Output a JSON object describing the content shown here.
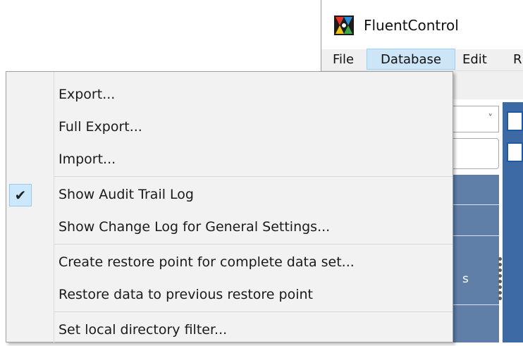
{
  "app": {
    "title": "FluentControl",
    "logo_icon": "fluentcontrol-logo-icon"
  },
  "menubar": {
    "items": [
      {
        "label": "File"
      },
      {
        "label": "Database"
      },
      {
        "label": "Edit"
      },
      {
        "label": "R"
      }
    ],
    "active_highlight": "#cde6f7"
  },
  "background": {
    "combo_text": ")",
    "combo_arrow": "˅",
    "panel_text": "s"
  },
  "dropdown": {
    "items": [
      {
        "label": "Export...",
        "checked": false
      },
      {
        "label": "Full Export...",
        "checked": false
      },
      {
        "label": "Import...",
        "checked": false
      },
      {
        "label": "Show Audit Trail Log",
        "checked": true
      },
      {
        "label": "Show Change Log for General Settings...",
        "checked": false
      },
      {
        "label": "Create restore point for complete data set...",
        "checked": false
      },
      {
        "label": "Restore data to previous restore point",
        "checked": false
      },
      {
        "label": "Set local directory filter...",
        "checked": false
      }
    ],
    "check_glyph": "✔",
    "check_bg": "#cce8ff"
  },
  "colors": {
    "panel_blue": "#5f7fa8",
    "strip_blue": "#3d6aa5"
  }
}
